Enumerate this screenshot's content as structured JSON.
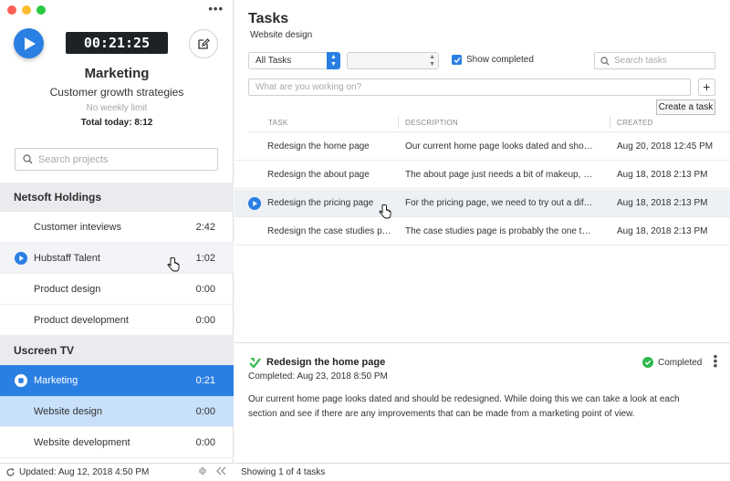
{
  "window": {
    "more_icon": "more-horizontal-icon"
  },
  "timer": {
    "value": "00:21:25",
    "project": "Marketing",
    "task": "Customer growth strategies",
    "limit": "No weekly limit",
    "total_today": "Total today: 8:12"
  },
  "sidebar": {
    "search_placeholder": "Search projects",
    "organizations": [
      {
        "name": "Netsoft Holdings",
        "projects": [
          {
            "name": "Customer inteviews",
            "time": "2:42"
          },
          {
            "name": "Hubstaff Talent",
            "time": "1:02"
          },
          {
            "name": "Product design",
            "time": "0:00"
          },
          {
            "name": "Product development",
            "time": "0:00"
          }
        ]
      },
      {
        "name": "Uscreen TV",
        "projects": [
          {
            "name": "Marketing",
            "time": "0:21"
          },
          {
            "name": "Website design",
            "time": "0:00"
          },
          {
            "name": "Website development",
            "time": "0:00"
          }
        ]
      }
    ],
    "footer": {
      "updated": "Updated: Aug 12, 2018 4:50 PM"
    }
  },
  "tasks": {
    "title": "Tasks",
    "subtitle": "Website design",
    "filter_selected": "All Tasks",
    "show_completed_label": "Show completed",
    "show_completed": true,
    "search_placeholder": "Search tasks",
    "new_task_placeholder": "What are you working on?",
    "add_button": "+",
    "tooltip": "Create a task",
    "columns": [
      "TASK",
      "DESCRIPTION",
      "CREATED"
    ],
    "rows": [
      {
        "task": "Redesign the home page",
        "description": "Our current home page looks dated and should...",
        "created": "Aug 20, 2018 12:45 PM"
      },
      {
        "task": "Redesign the about page",
        "description": "The about page just needs a bit of makeup, bec...",
        "created": "Aug 18, 2018 2:13 PM"
      },
      {
        "task": "Redesign the pricing page",
        "description": "For the pricing page, we need to try out a differe...",
        "created": "Aug 18, 2018 2:13 PM"
      },
      {
        "task": "Redesign the case studies pa...",
        "description": "The case studies page is probably the one that ...",
        "created": "Aug 18, 2018 2:13 PM"
      }
    ],
    "footer": "Showing 1 of 4 tasks"
  },
  "detail": {
    "title": "Redesign the home page",
    "completed_at": "Completed: Aug 23, 2018 8:50 PM",
    "status": "Completed",
    "body": "Our current home page looks dated and should be redesigned. While doing this we can take a look at each section and see if there are any improvements that can be made from a marketing point of view."
  },
  "colors": {
    "accent": "#2a7fe3",
    "success": "#2fb84c",
    "timer_bg": "#1e2226",
    "org_header_bg": "#e9ebee",
    "active_row": "#2a7fe3",
    "sub_active_row": "#c8e0f9"
  }
}
